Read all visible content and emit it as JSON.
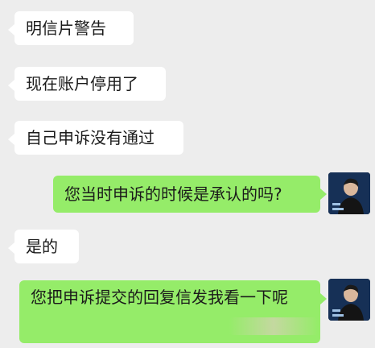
{
  "messages": [
    {
      "side": "in",
      "text": "明信片警告"
    },
    {
      "side": "in",
      "text": "现在账户停用了"
    },
    {
      "side": "in",
      "text": "自己申诉没有通过"
    },
    {
      "side": "out",
      "text": "您当时申诉的时候是承认的吗?"
    },
    {
      "side": "in",
      "text": "是的"
    },
    {
      "side": "out",
      "text": "您把申诉提交的回复信发我看一下呢"
    }
  ],
  "colors": {
    "background": "#ededed",
    "incoming_bubble": "#ffffff",
    "outgoing_bubble": "#95ec69",
    "avatar_bg": "#0f1f3a"
  },
  "avatar_icon": "user-avatar-icon"
}
